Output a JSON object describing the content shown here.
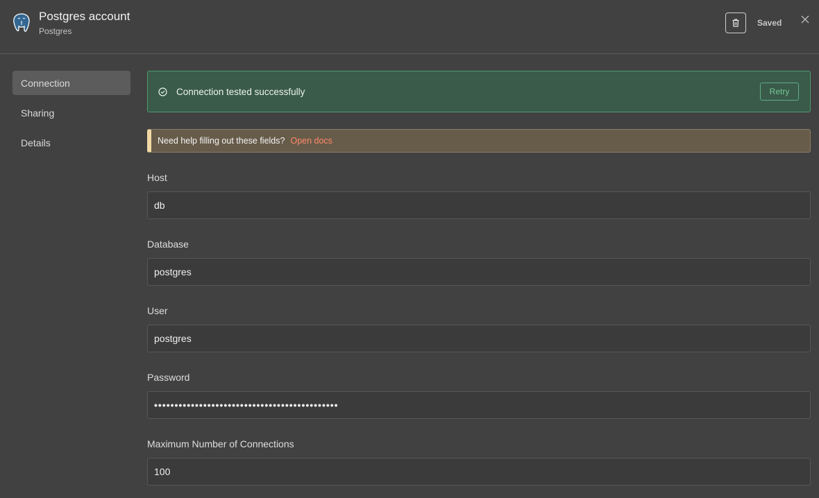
{
  "header": {
    "title": "Postgres account",
    "subtitle": "Postgres",
    "saved_label": "Saved",
    "icons": {
      "logo": "postgres-elephant-icon",
      "delete": "trash-icon",
      "close": "close-icon"
    }
  },
  "sidebar": {
    "items": [
      {
        "label": "Connection",
        "active": true
      },
      {
        "label": "Sharing",
        "active": false
      },
      {
        "label": "Details",
        "active": false
      }
    ]
  },
  "status": {
    "message": "Connection tested successfully",
    "retry_label": "Retry",
    "icon": "check-circle-icon"
  },
  "help": {
    "text": "Need help filling out these fields?",
    "link": "Open docs"
  },
  "fields": {
    "host": {
      "label": "Host",
      "value": "db"
    },
    "database": {
      "label": "Database",
      "value": "postgres"
    },
    "user": {
      "label": "User",
      "value": "postgres"
    },
    "password": {
      "label": "Password",
      "value": "•••••••••••••••••••••••••••••••••••••••••••••"
    },
    "max_connections": {
      "label": "Maximum Number of Connections",
      "value": "100"
    }
  },
  "colors": {
    "background": "#414141",
    "success_bg": "#3a5b49",
    "success_border": "#4f9b72",
    "help_bg": "#675c4a",
    "help_accent": "#f2d9a6",
    "link": "#ff8a6a"
  }
}
